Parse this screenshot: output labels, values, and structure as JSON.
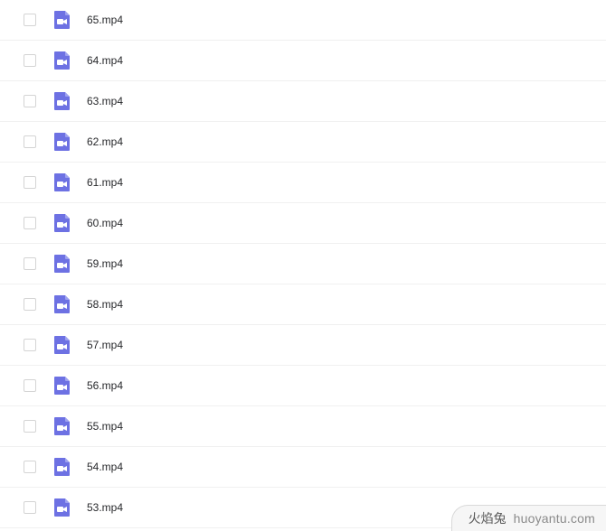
{
  "files": [
    {
      "name": "65.mp4"
    },
    {
      "name": "64.mp4"
    },
    {
      "name": "63.mp4"
    },
    {
      "name": "62.mp4"
    },
    {
      "name": "61.mp4"
    },
    {
      "name": "60.mp4"
    },
    {
      "name": "59.mp4"
    },
    {
      "name": "58.mp4"
    },
    {
      "name": "57.mp4"
    },
    {
      "name": "56.mp4"
    },
    {
      "name": "55.mp4"
    },
    {
      "name": "54.mp4"
    },
    {
      "name": "53.mp4"
    }
  ],
  "icon_color": "#6d71e3",
  "watermark": {
    "cn": "火焰兔",
    "en": "huoyantu.com"
  }
}
